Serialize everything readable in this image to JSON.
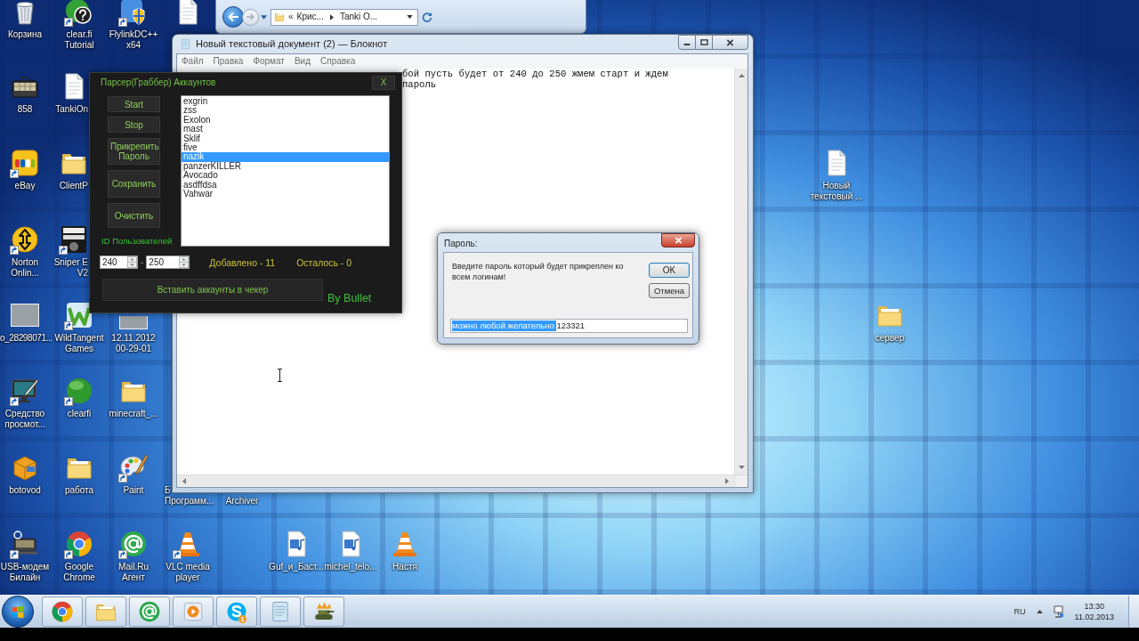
{
  "desktop_icons": [
    {
      "kind": "bin",
      "label": [
        "Корзина"
      ],
      "shortcut": false
    },
    {
      "kind": "help",
      "label": [
        "clear.fi",
        "Tutorial"
      ],
      "shortcut": true
    },
    {
      "kind": "shield",
      "label": [
        "FlylinkDC++",
        "x64"
      ],
      "shortcut": true
    },
    {
      "kind": "document",
      "shortcut": false
    },
    {
      "kind": "briefcase",
      "label": [
        "858"
      ],
      "shortcut": false
    },
    {
      "kind": "document",
      "label": [
        "TankiOn"
      ],
      "shortcut": false
    },
    {
      "kind": "ebay",
      "label": [
        "eBay"
      ],
      "shortcut": true
    },
    {
      "kind": "folder",
      "label": [
        "ClientP"
      ],
      "shortcut": false
    },
    {
      "kind": "document",
      "label": [
        "Новый",
        "текстовый ..."
      ],
      "shortcut": false
    },
    {
      "kind": "norton",
      "label": [
        "Norton",
        "Onlin..."
      ],
      "shortcut": true
    },
    {
      "kind": "game",
      "label": [
        "Sniper E",
        "V2"
      ],
      "shortcut": true
    },
    {
      "kind": "photo",
      "label": [
        "o_28298071..."
      ],
      "shortcut": false
    },
    {
      "kind": "wildtangent",
      "label": [
        "WildTangent",
        "Games"
      ],
      "shortcut": true
    },
    {
      "kind": "photo",
      "label": [
        "12.11.2012",
        "00-29-01"
      ],
      "shortcut": false
    },
    {
      "kind": "folder",
      "label": [
        "сервер"
      ],
      "shortcut": false
    },
    {
      "kind": "monitor",
      "label": [
        "Средство",
        "просмот..."
      ],
      "shortcut": true
    },
    {
      "kind": "ball",
      "label": [
        "clearfi"
      ],
      "shortcut": true
    },
    {
      "kind": "folder",
      "label": [
        "minecraft_..."
      ],
      "shortcut": false
    },
    {
      "kind": "box",
      "label": [
        "botovod"
      ],
      "shortcut": false
    },
    {
      "kind": "folder",
      "label": [
        "работа"
      ],
      "shortcut": false
    },
    {
      "kind": "palette",
      "label": [
        "Paint"
      ],
      "shortcut": true
    },
    {
      "label": [
        "Б",
        "Программ..."
      ]
    },
    {
      "label": [
        "Archiver"
      ]
    },
    {
      "kind": "modem",
      "label": [
        "USB-модем",
        "Билайн"
      ],
      "shortcut": true
    },
    {
      "kind": "browser",
      "label": [
        "Google",
        "Chrome"
      ],
      "shortcut": true
    },
    {
      "kind": "at",
      "label": [
        "Mail.Ru",
        "Агент"
      ],
      "shortcut": true
    },
    {
      "kind": "cone",
      "label": [
        "VLC media",
        "player"
      ],
      "shortcut": true
    },
    {
      "kind": "audio",
      "label": [
        "Guf_и_Баст..."
      ],
      "shortcut": false
    },
    {
      "kind": "audio",
      "label": [
        "michel_telo..."
      ],
      "shortcut": false
    },
    {
      "kind": "cone",
      "label": [
        "Настя"
      ],
      "shortcut": false
    }
  ],
  "explorer_window": {
    "breadcrumb_overflow": "«",
    "breadcrumb": [
      "Крис...",
      "Tanki O..."
    ]
  },
  "notepad": {
    "title": "Новый текстовый документ (2) — Блокнот",
    "menu": [
      "Файл",
      "Правка",
      "Формат",
      "Вид",
      "Справка"
    ],
    "lines": [
      "бой пусть будет от 240 до 250 жмем старт и ждем",
      "пароль"
    ]
  },
  "parser_window": {
    "title": "Парсер(Граббер) Аккаунтов",
    "close_label": "X",
    "buttons": [
      "Start",
      "Stop",
      "Прикрепить Пароль",
      "Сохранить",
      "Очистить"
    ],
    "id_label": "ID Пользователей",
    "accounts": [
      {
        "name": "exgrin",
        "selected": false
      },
      {
        "name": "zss",
        "selected": false
      },
      {
        "name": "Exolon",
        "selected": false
      },
      {
        "name": "mast",
        "selected": false
      },
      {
        "name": "Sklif",
        "selected": false
      },
      {
        "name": "five",
        "selected": false
      },
      {
        "name": "nazik",
        "selected": true
      },
      {
        "name": "panzerKILLER",
        "selected": false
      },
      {
        "name": "Avocado",
        "selected": false
      },
      {
        "name": "asdffdsa",
        "selected": false
      },
      {
        "name": "Vahwar",
        "selected": false
      }
    ],
    "id_from": "240",
    "range_separator": "-",
    "id_to": "250",
    "added": "Добавлено - 11",
    "remaining": "Осталось - 0",
    "insert_button": "Вставить аккаунты в чекер",
    "credit": "By Bullet"
  },
  "password_dialog": {
    "title": "Пароль:",
    "message": "Введите пароль который будет прикреплен ко всем логинам!",
    "ok": "OK",
    "cancel": "Отмена",
    "input_selected": "можно любой желательно ",
    "input_rest": "123321"
  },
  "taskbar": {
    "apps": [
      {
        "kind": "browser"
      },
      {
        "kind": "explorer"
      },
      {
        "kind": "mail"
      },
      {
        "kind": "media"
      },
      {
        "kind": "messenger",
        "badge": "1"
      },
      {
        "kind": "notepad"
      },
      {
        "kind": "game"
      }
    ],
    "language": "RU",
    "time": "13:30",
    "date": "11.02.2013"
  }
}
